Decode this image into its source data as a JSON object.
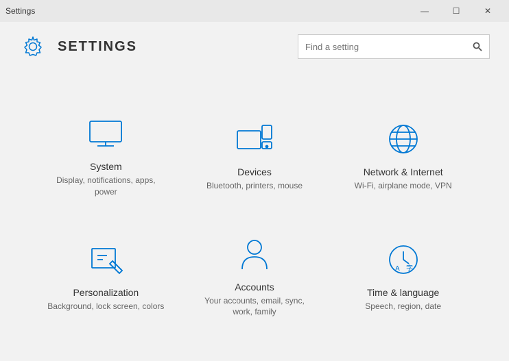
{
  "window": {
    "title": "Settings"
  },
  "title_bar": {
    "title": "Settings",
    "minimize_label": "—",
    "maximize_label": "☐",
    "close_label": "✕"
  },
  "header": {
    "title": "SETTINGS",
    "search_placeholder": "Find a setting"
  },
  "tiles": [
    {
      "id": "system",
      "title": "System",
      "subtitle": "Display, notifications, apps, power",
      "icon": "system"
    },
    {
      "id": "devices",
      "title": "Devices",
      "subtitle": "Bluetooth, printers, mouse",
      "icon": "devices"
    },
    {
      "id": "network",
      "title": "Network & Internet",
      "subtitle": "Wi-Fi, airplane mode, VPN",
      "icon": "network"
    },
    {
      "id": "personalization",
      "title": "Personalization",
      "subtitle": "Background, lock screen, colors",
      "icon": "personalization"
    },
    {
      "id": "accounts",
      "title": "Accounts",
      "subtitle": "Your accounts, email, sync, work, family",
      "icon": "accounts"
    },
    {
      "id": "time",
      "title": "Time & language",
      "subtitle": "Speech, region, date",
      "icon": "time"
    }
  ]
}
